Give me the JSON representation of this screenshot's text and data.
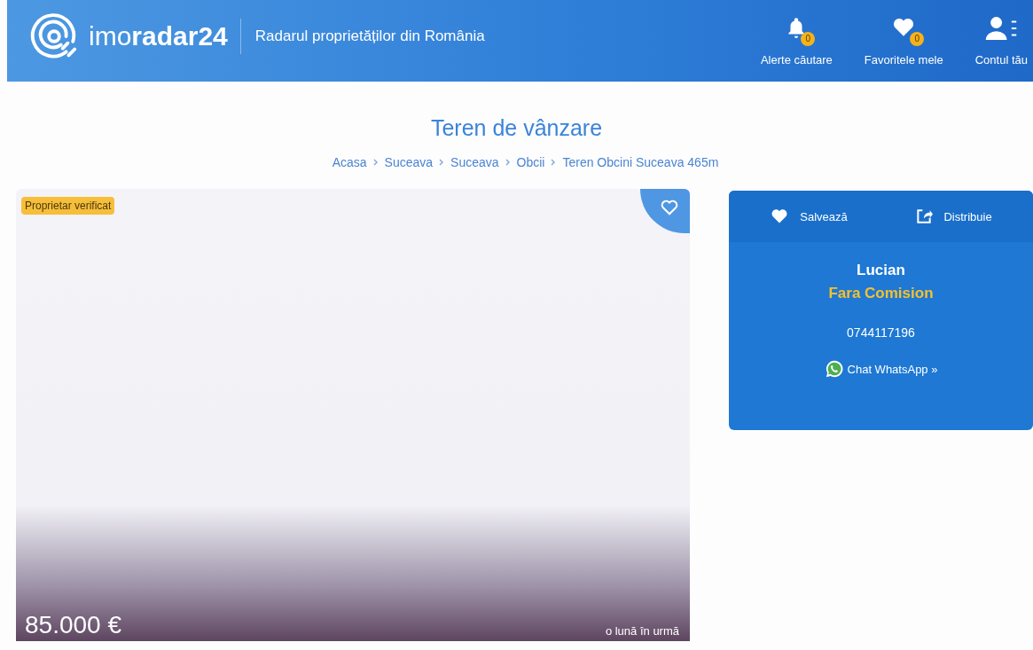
{
  "header": {
    "logo": "imo**radar24**",
    "tagline": "Radarul proprietăților din România",
    "nav": [
      {
        "kind": "bell",
        "label": "Alerte căutare",
        "badge": "0"
      },
      {
        "kind": "heart",
        "label": "Favoritele mele",
        "badge": "0"
      },
      {
        "kind": "user",
        "label": "Contul tău"
      }
    ]
  },
  "title": "Teren de vânzare",
  "breadcrumb": [
    "Acasa",
    "Suceava",
    "Suceava",
    "Obcii",
    "Teren Obcini Suceava 465m"
  ],
  "listing": {
    "badge": "Proprietar verificat",
    "price": "85.000 €",
    "posted": "o lună în urmă"
  },
  "contact": {
    "actions": [
      {
        "kind": "save",
        "label": "Salvează"
      },
      {
        "kind": "share",
        "label": "Distribuie"
      }
    ],
    "name": "Lucian",
    "note": "Fara Comision",
    "phone": "0744117196",
    "chat": "Chat WhatsApp »"
  }
}
